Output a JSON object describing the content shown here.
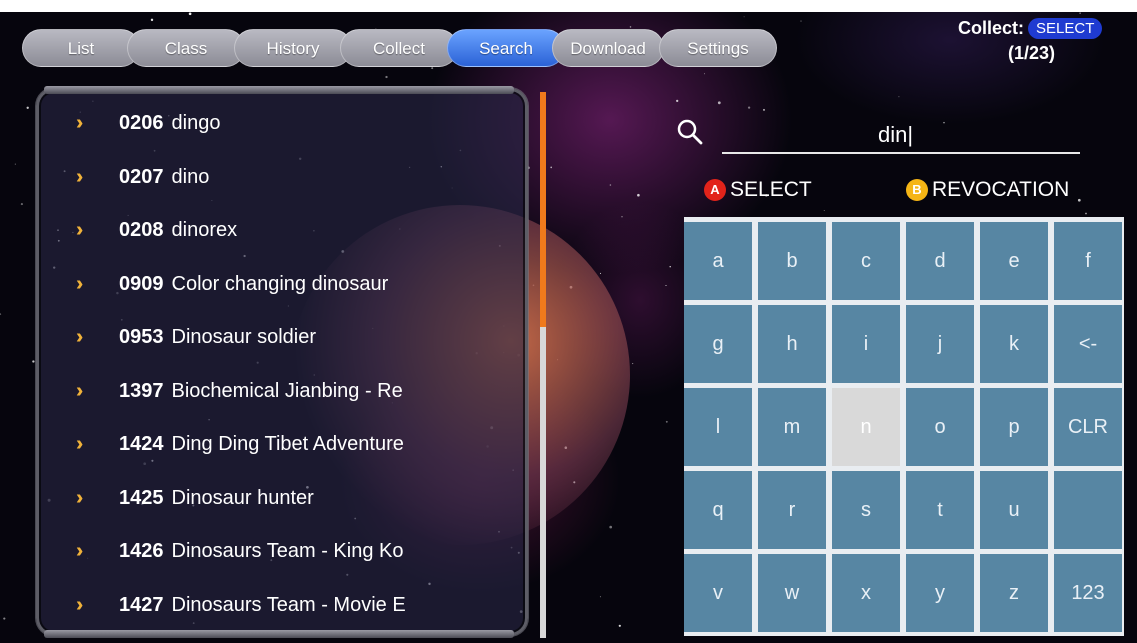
{
  "tabs": [
    "List",
    "Class",
    "History",
    "Collect",
    "Search",
    "Download",
    "Settings"
  ],
  "active_tab": "Search",
  "collect": {
    "label": "Collect:",
    "badge": "SELECT",
    "count": "(1/23)"
  },
  "search": {
    "query": "din|"
  },
  "hints": {
    "a_key": "A",
    "a_label": "SELECT",
    "b_key": "B",
    "b_label": "REVOCATION"
  },
  "results": [
    {
      "code": "0206",
      "name": "dingo"
    },
    {
      "code": "0207",
      "name": "dino"
    },
    {
      "code": "0208",
      "name": "dinorex"
    },
    {
      "code": "0909",
      "name": "Color changing dinosaur"
    },
    {
      "code": "0953",
      "name": "Dinosaur soldier"
    },
    {
      "code": "1397",
      "name": "Biochemical Jianbing - Re"
    },
    {
      "code": "1424",
      "name": "Ding Ding Tibet Adventure"
    },
    {
      "code": "1425",
      "name": "Dinosaur hunter"
    },
    {
      "code": "1426",
      "name": "Dinosaurs Team - King Ko"
    },
    {
      "code": "1427",
      "name": "Dinosaurs Team - Movie E"
    }
  ],
  "keyboard": [
    [
      "a",
      "b",
      "c",
      "d",
      "e",
      "f"
    ],
    [
      "g",
      "h",
      "i",
      "j",
      "k",
      "<-"
    ],
    [
      "l",
      "m",
      "n",
      "o",
      "p",
      "CLR"
    ],
    [
      "q",
      "r",
      "s",
      "t",
      "u",
      ""
    ],
    [
      "v",
      "w",
      "x",
      "y",
      "z",
      "123"
    ]
  ],
  "focused_key": "n",
  "scroll_fraction": 0.43,
  "colors": {
    "active_tab": "#2b62d6",
    "accent": "#f0b23a",
    "key": "#5786a3",
    "scroll": "#f07a1c"
  },
  "icons": {
    "search": "search-icon",
    "chevron": "chevron-double-right-icon"
  }
}
